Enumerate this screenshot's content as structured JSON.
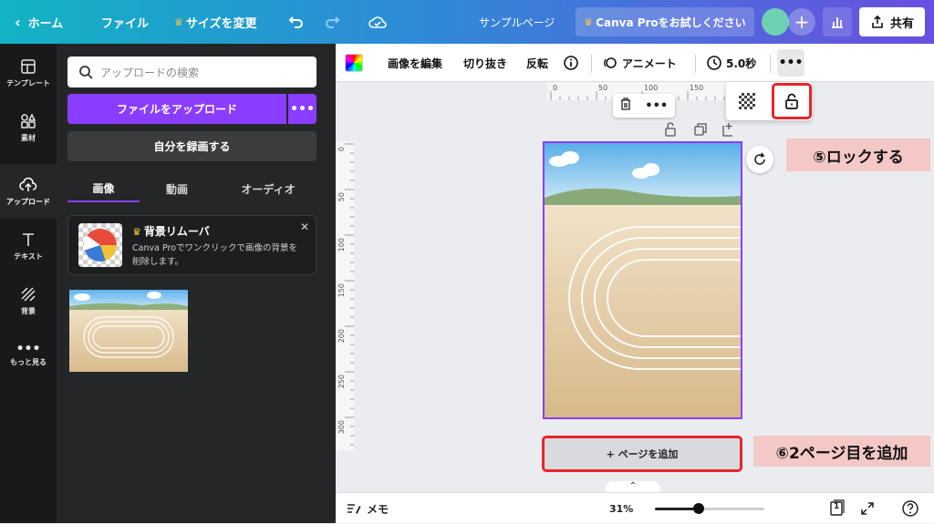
{
  "topbar": {
    "home": "ホーム",
    "file": "ファイル",
    "resize": "サイズを変更",
    "design_name": "サンプルページ",
    "pro_trial": "Canva Proをお試しください",
    "share": "共有"
  },
  "rail": {
    "items": [
      {
        "label": "テンプレート",
        "icon": "template-icon"
      },
      {
        "label": "素材",
        "icon": "elements-icon"
      },
      {
        "label": "アップロード",
        "icon": "upload-cloud-icon"
      },
      {
        "label": "テキスト",
        "icon": "text-icon"
      },
      {
        "label": "背景",
        "icon": "background-icon"
      },
      {
        "label": "もっと見る",
        "icon": "more-dots-icon"
      }
    ]
  },
  "panel": {
    "search_placeholder": "アップロードの検索",
    "upload_button": "ファイルをアップロード",
    "record_button": "自分を録画する",
    "tabs": [
      "画像",
      "動画",
      "オーディオ"
    ],
    "promo": {
      "title": "背景リムーバ",
      "description": "Canva Proでワンクリックで画像の背景を削除します。"
    }
  },
  "context_toolbar": {
    "edit_image": "画像を編集",
    "crop": "切り抜き",
    "flip": "反転",
    "animate": "アニメート",
    "duration": "5.0秒"
  },
  "ruler": {
    "top_ticks": [
      "0",
      "50",
      "100",
      "150"
    ],
    "left_ticks": [
      "0",
      "50",
      "100",
      "150",
      "200",
      "250",
      "300"
    ]
  },
  "canvas": {
    "add_page": "+ ページを追加"
  },
  "annotations": {
    "lock_step": "⑤ロックする",
    "add_page_step": "⑥2ページ目を追加"
  },
  "bottombar": {
    "notes": "メモ",
    "zoom": "31%",
    "zoom_level": 0.4,
    "page_count": "1"
  },
  "colors": {
    "accent": "#8b3dff",
    "highlight_red": "#e8262a",
    "callout_bg": "#f4c8c6"
  }
}
